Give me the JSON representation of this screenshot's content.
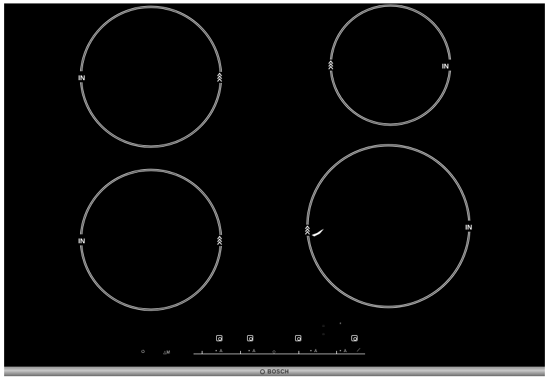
{
  "zones": [
    {
      "id": "rear-left",
      "label": "IN"
    },
    {
      "id": "rear-right",
      "label": "IN"
    },
    {
      "id": "front-left",
      "label": "IN"
    },
    {
      "id": "front-right",
      "label": "IN"
    }
  ],
  "controls": {
    "power_symbol": "⏻",
    "power_label": "",
    "lock_symbol": "△",
    "lock_label": "M",
    "slider_symbols": [
      "•",
      "A",
      "•",
      "A",
      "◇",
      "•",
      "A",
      "•",
      "A"
    ],
    "indicators": [
      "8",
      "□",
      "□"
    ]
  },
  "brand": {
    "name": "BOSCH"
  },
  "colors": {
    "glass": "#000000",
    "trim": "#ffffff",
    "rim": "#b5b5b5"
  }
}
